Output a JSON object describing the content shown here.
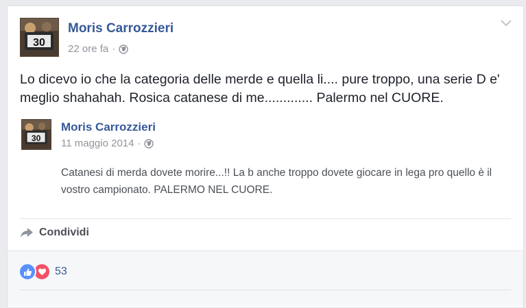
{
  "post": {
    "author": "Moris Carrozzieri",
    "timestamp": "22 ore fa",
    "separator": "·",
    "privacy_icon": "globe-icon",
    "avatar_badge": "30",
    "text": "Lo dicevo io che la categoria delle merde e quella li.... pure troppo, una serie D e' meglio shahahah. Rosica catanese di me............. Palermo nel CUORE.",
    "options_icon": "chevron-down-icon"
  },
  "shared_post": {
    "author": "Moris Carrozzieri",
    "timestamp": "11 maggio 2014",
    "separator": "·",
    "privacy_icon": "globe-icon",
    "avatar_badge": "30",
    "text": "Catanesi di merda dovete morire...!! La b anche troppo dovete giocare in lega pro quello è il vostro campionato. PALERMO NEL CUORE."
  },
  "actions": {
    "share_label": "Condividi",
    "share_icon": "share-arrow-icon"
  },
  "reactions": {
    "types": [
      "like",
      "love"
    ],
    "count": "53",
    "colors": {
      "like": "#5890ff",
      "love": "#f25268"
    }
  },
  "colors": {
    "link": "#365899",
    "meta": "#90949c",
    "background": "#e9ebee"
  }
}
